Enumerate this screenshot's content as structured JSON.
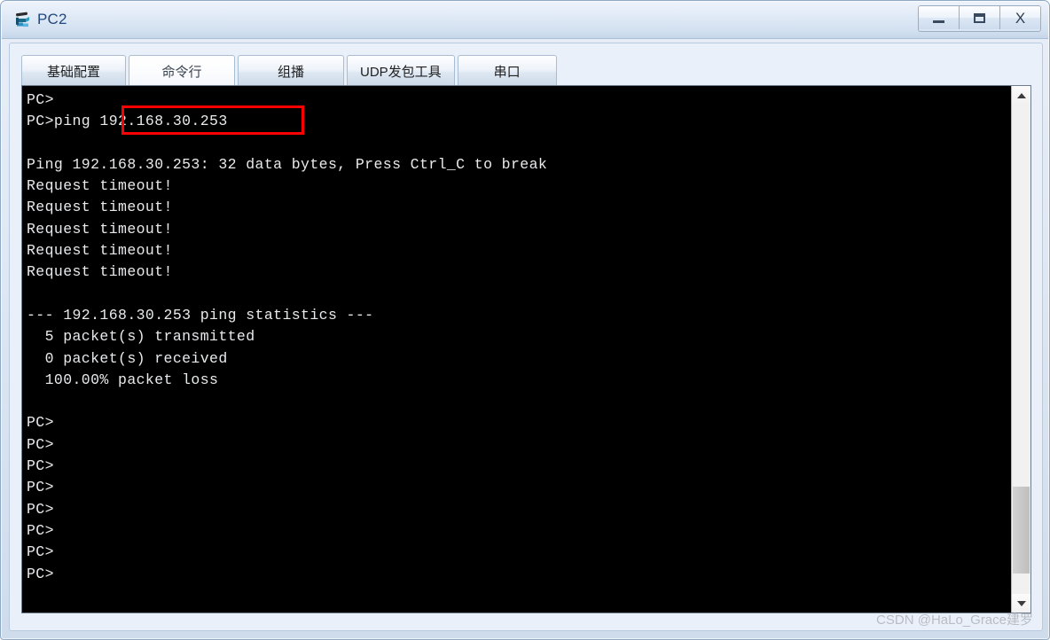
{
  "window": {
    "title": "PC2",
    "icon": "pc-device-icon",
    "controls": {
      "minimize_label": "_",
      "maximize_label": "▭",
      "close_label": "X"
    }
  },
  "tabs": [
    {
      "label": "基础配置",
      "active": false
    },
    {
      "label": "命令行",
      "active": true
    },
    {
      "label": "组播",
      "active": false
    },
    {
      "label": "UDP发包工具",
      "active": false
    },
    {
      "label": "串口",
      "active": false
    }
  ],
  "terminal": {
    "lines": [
      "PC>",
      "PC>ping 192.168.30.253",
      "",
      "Ping 192.168.30.253: 32 data bytes, Press Ctrl_C to break",
      "Request timeout!",
      "Request timeout!",
      "Request timeout!",
      "Request timeout!",
      "Request timeout!",
      "",
      "--- 192.168.30.253 ping statistics ---",
      "  5 packet(s) transmitted",
      "  0 packet(s) received",
      "  100.00% packet loss",
      "",
      "PC>",
      "PC>",
      "PC>",
      "PC>",
      "PC>",
      "PC>",
      "PC>",
      "PC>"
    ],
    "highlight": {
      "text": "192.168.30.253",
      "color": "#ff0000"
    },
    "background": "#000000",
    "foreground": "#e9eaec"
  },
  "scrollbar": {
    "up_arrow": "chevron-up-icon",
    "down_arrow": "chevron-down-icon"
  },
  "watermark": {
    "text": "CSDN @HaLo_Grace建罗"
  }
}
